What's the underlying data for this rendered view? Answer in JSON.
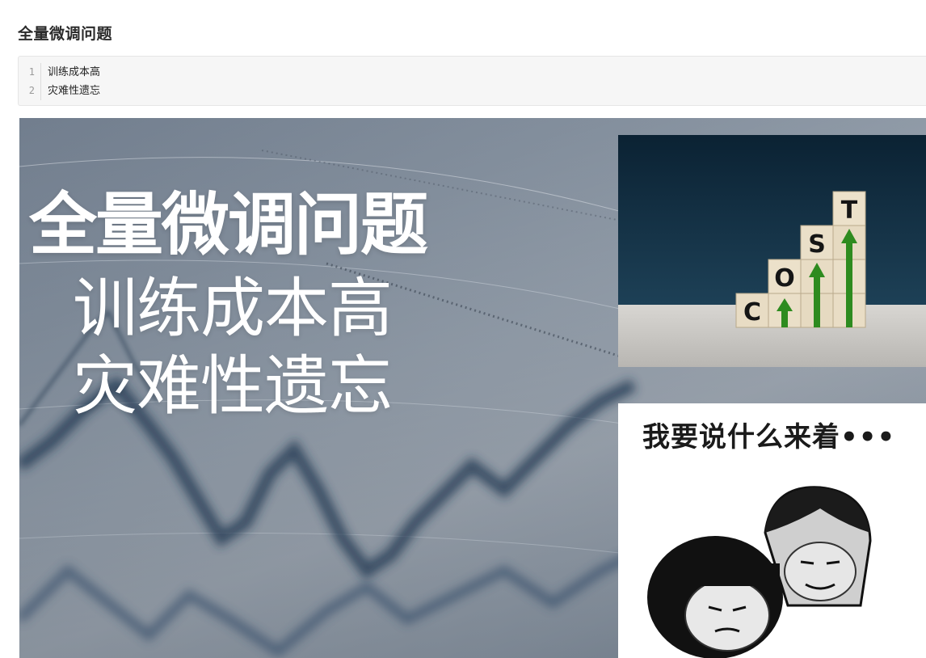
{
  "heading": "全量微调问题",
  "code_block": {
    "lines": [
      {
        "num": "1",
        "text": "训练成本高"
      },
      {
        "num": "2",
        "text": "灾难性遗忘"
      }
    ]
  },
  "slide": {
    "title": "全量微调问题",
    "line1": "训练成本高",
    "line2": "灾难性遗忘",
    "cost_image": {
      "letters": [
        "C",
        "O",
        "S",
        "T"
      ],
      "arrow_color": "#2e8b1f"
    },
    "meme_image": {
      "caption": "我要说什么来着•••"
    }
  }
}
